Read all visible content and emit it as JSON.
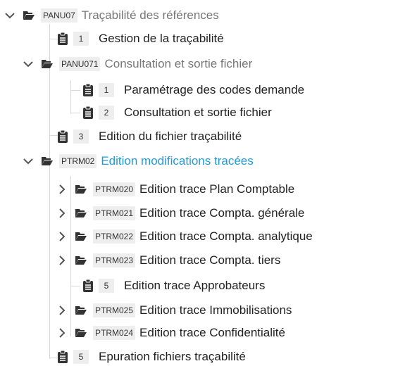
{
  "tree": {
    "rows": [
      {
        "type": "folder",
        "state": "expanded",
        "code": "PANU07",
        "label": "Traçabilité des références"
      },
      {
        "type": "item",
        "num": "1",
        "label": "Gestion de la traçabilité"
      },
      {
        "type": "folder",
        "state": "expanded",
        "code": "PANU071",
        "label": "Consultation et sortie fichier"
      },
      {
        "type": "item",
        "num": "1",
        "label": "Paramétrage des codes demande"
      },
      {
        "type": "item",
        "num": "2",
        "label": "Consultation et sortie fichier"
      },
      {
        "type": "item",
        "num": "3",
        "label": "Edition du fichier traçabilité"
      },
      {
        "type": "folder",
        "state": "expanded",
        "selected": true,
        "code": "PTRM02",
        "label": "Edition modifications tracées"
      },
      {
        "type": "folder",
        "state": "collapsed",
        "code": "PTRM020",
        "label": "Edition trace Plan Comptable"
      },
      {
        "type": "folder",
        "state": "collapsed",
        "code": "PTRM021",
        "label": "Edition trace Compta. générale"
      },
      {
        "type": "folder",
        "state": "collapsed",
        "code": "PTRM022",
        "label": "Edition trace Compta. analytique"
      },
      {
        "type": "folder",
        "state": "collapsed",
        "code": "PTRM023",
        "label": "Edition trace Compta. tiers"
      },
      {
        "type": "item",
        "num": "5",
        "label": "Edition trace Approbateurs"
      },
      {
        "type": "folder",
        "state": "collapsed",
        "code": "PTRM025",
        "label": "Edition trace Immobilisations"
      },
      {
        "type": "folder",
        "state": "collapsed",
        "code": "PTRM024",
        "label": "Edition trace Confidentialité"
      },
      {
        "type": "item",
        "num": "5",
        "label": "Epuration fichiers traçabilité"
      }
    ]
  },
  "icons": {
    "expand": "chevron-down-icon",
    "collapse": "chevron-right-icon",
    "folder": "folder-open-icon",
    "item": "clipboard-icon"
  },
  "colors": {
    "selected_text": "#1f9bdb",
    "muted_text": "#777777",
    "default_text": "#222222",
    "code_badge_bg": "#eeeeee",
    "icon": "#333333",
    "tree_line": "#d8d8d8"
  }
}
